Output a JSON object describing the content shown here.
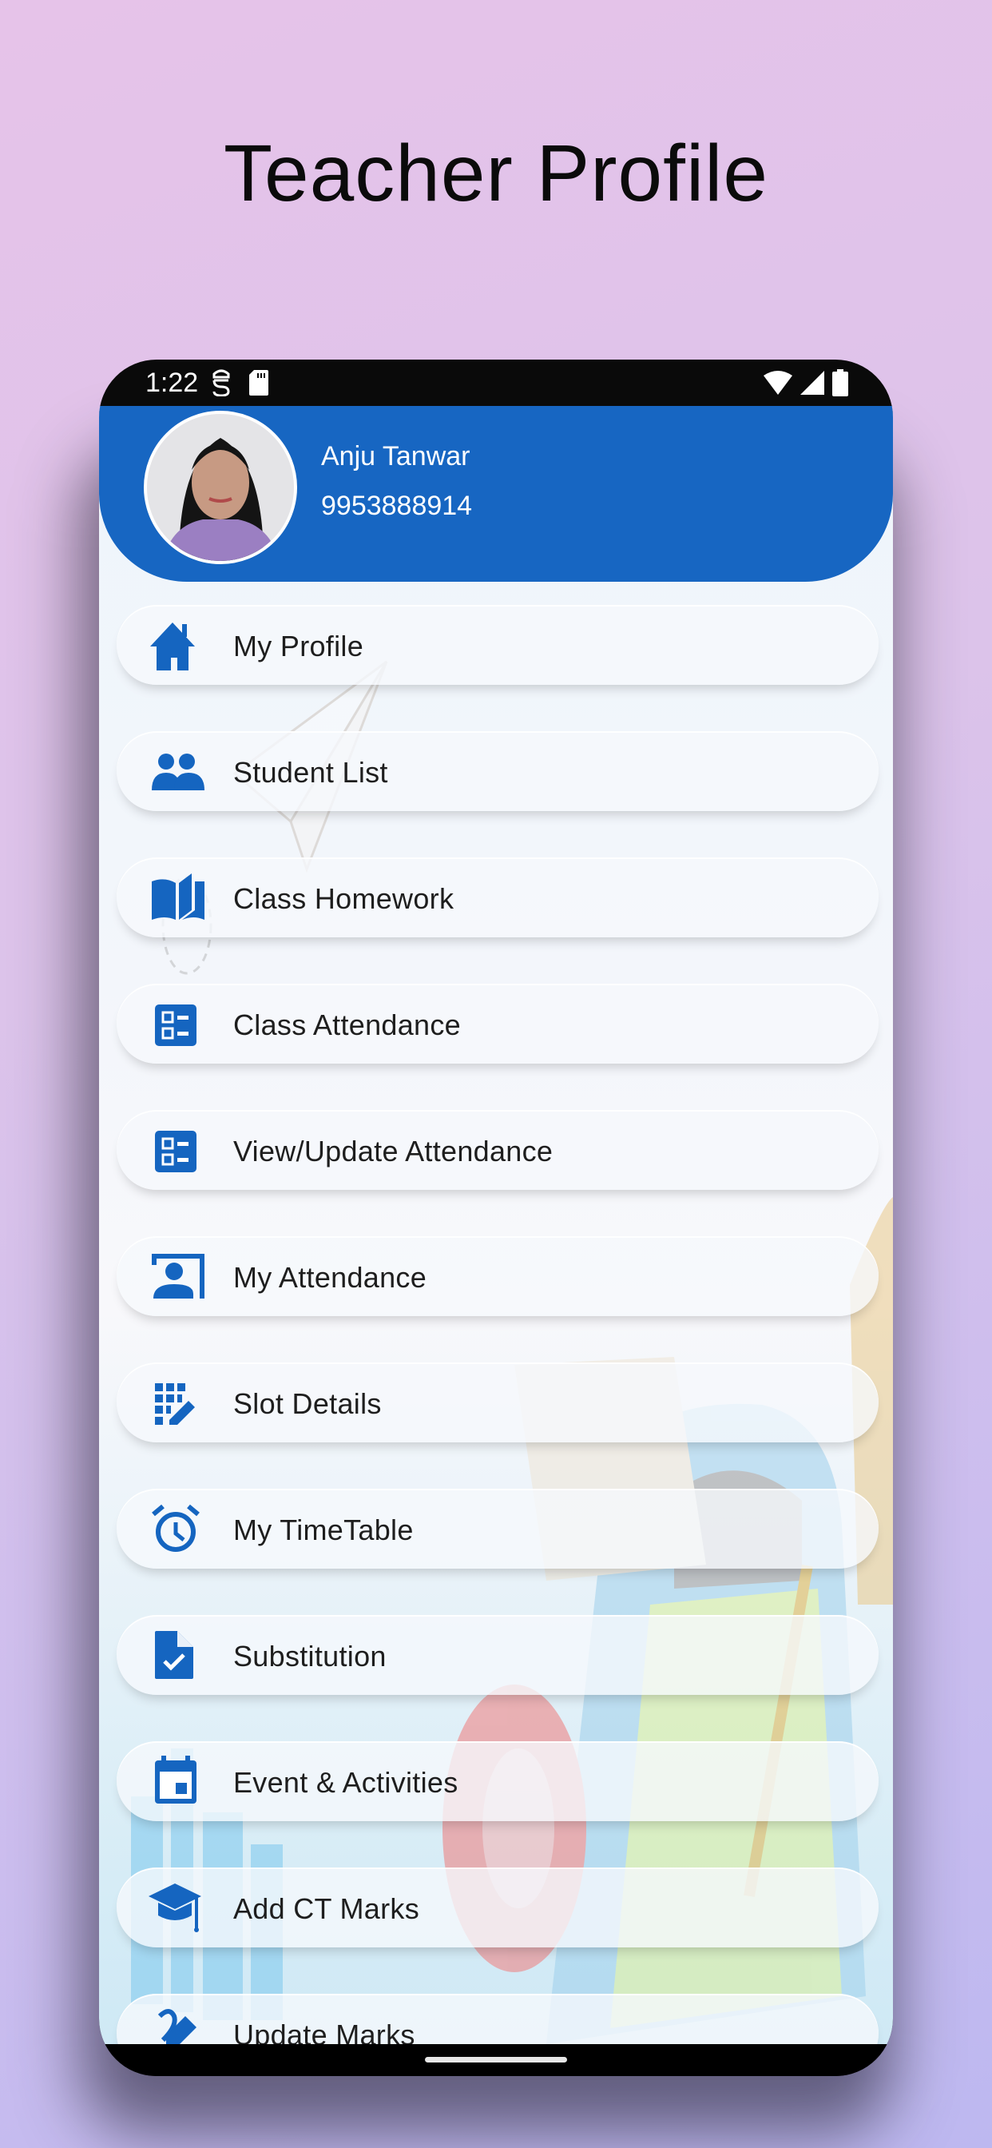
{
  "promo": {
    "title": "Teacher Profile"
  },
  "status_bar": {
    "time": "1:22",
    "left_icons": [
      "notification-app-icon",
      "sd-card-icon"
    ],
    "right_icons": [
      "wifi-icon",
      "cell-signal-icon",
      "battery-icon"
    ]
  },
  "profile": {
    "name": "Anju Tanwar",
    "phone": "9953888914",
    "avatar": "teacher-photo"
  },
  "menu": {
    "items": [
      {
        "label": "My Profile",
        "icon": "home-icon"
      },
      {
        "label": "Student List",
        "icon": "people-icon"
      },
      {
        "label": "Class Homework",
        "icon": "book-icon"
      },
      {
        "label": "Class Attendance",
        "icon": "checklist-icon"
      },
      {
        "label": "View/Update Attendance",
        "icon": "checklist-icon"
      },
      {
        "label": "My Attendance",
        "icon": "contact-card-icon"
      },
      {
        "label": "Slot Details",
        "icon": "grid-edit-icon"
      },
      {
        "label": "My TimeTable",
        "icon": "alarm-clock-icon"
      },
      {
        "label": "Substitution",
        "icon": "document-check-icon"
      },
      {
        "label": "Event & Activities",
        "icon": "calendar-icon"
      },
      {
        "label": "Add CT Marks",
        "icon": "graduation-cap-icon"
      },
      {
        "label": "Update Marks",
        "icon": "edit-marks-icon"
      }
    ]
  },
  "colors": {
    "brand_blue": "#1766c2",
    "icon_blue": "#1565c0",
    "text_dark": "#1e1e1e"
  }
}
